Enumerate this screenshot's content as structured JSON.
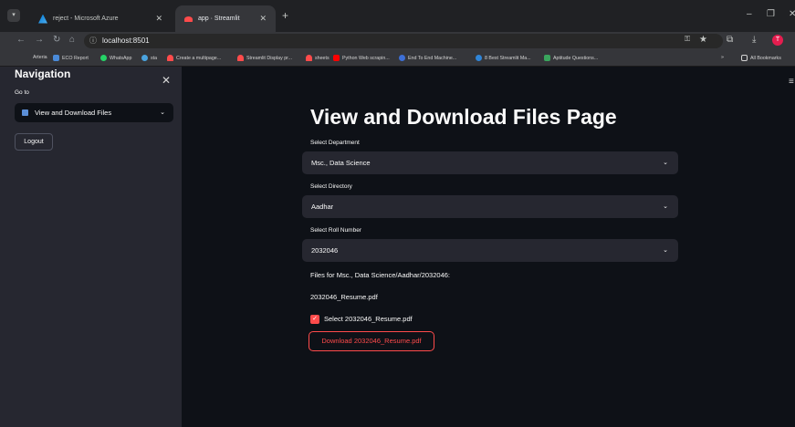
{
  "browser": {
    "tabs": [
      {
        "title": "reject - Microsoft Azure"
      },
      {
        "title": "app · Streamlit"
      }
    ],
    "url": "localhost:8501",
    "bookmarks": [
      {
        "label": "Arteria"
      },
      {
        "label": "ECO Report"
      },
      {
        "label": "WhatsApp"
      },
      {
        "label": "sta"
      },
      {
        "label": "Create a multipage..."
      },
      {
        "label": "Streamlit Display pr..."
      },
      {
        "label": "sheets"
      },
      {
        "label": "Python Web scrapin..."
      },
      {
        "label": "End To End Machine..."
      },
      {
        "label": "8 Best Streamlit Ma..."
      },
      {
        "label": "Aptitude Questions..."
      }
    ],
    "all_bookmarks": "All Bookmarks",
    "profile_initial": "T"
  },
  "sidebar": {
    "title": "Navigation",
    "goto_label": "Go to",
    "selected_page": "View and Download Files",
    "logout_label": "Logout"
  },
  "main": {
    "title": "View and Download Files Page",
    "department": {
      "label": "Select Department",
      "value": "Msc., Data Science"
    },
    "directory": {
      "label": "Select Directory",
      "value": "Aadhar"
    },
    "roll": {
      "label": "Select Roll Number",
      "value": "2032046"
    },
    "files_heading": "Files for Msc., Data Science/Aadhar/2032046:",
    "file_name": "2032046_Resume.pdf",
    "checkbox_label": "Select 2032046_Resume.pdf",
    "download_label": "Download 2032046_Resume.pdf"
  },
  "colors": {
    "accent": "#ff4b4b",
    "sidebar_bg": "#262730",
    "main_bg": "#0e1117"
  }
}
